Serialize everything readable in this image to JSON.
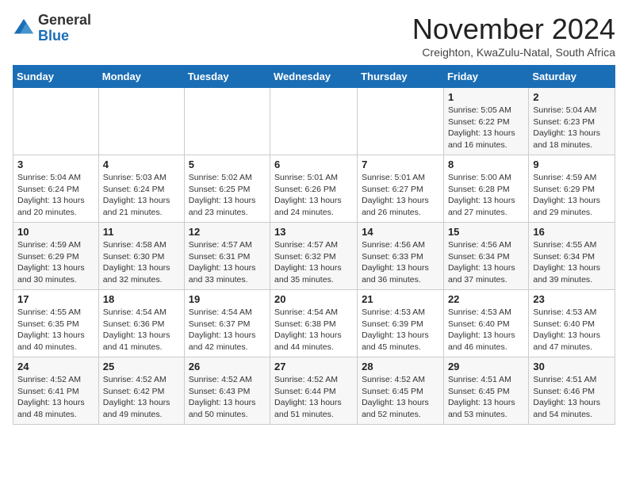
{
  "logo": {
    "text_general": "General",
    "text_blue": "Blue"
  },
  "title": "November 2024",
  "subtitle": "Creighton, KwaZulu-Natal, South Africa",
  "days_of_week": [
    "Sunday",
    "Monday",
    "Tuesday",
    "Wednesday",
    "Thursday",
    "Friday",
    "Saturday"
  ],
  "weeks": [
    [
      {
        "day": "",
        "info": ""
      },
      {
        "day": "",
        "info": ""
      },
      {
        "day": "",
        "info": ""
      },
      {
        "day": "",
        "info": ""
      },
      {
        "day": "",
        "info": ""
      },
      {
        "day": "1",
        "info": "Sunrise: 5:05 AM\nSunset: 6:22 PM\nDaylight: 13 hours and 16 minutes."
      },
      {
        "day": "2",
        "info": "Sunrise: 5:04 AM\nSunset: 6:23 PM\nDaylight: 13 hours and 18 minutes."
      }
    ],
    [
      {
        "day": "3",
        "info": "Sunrise: 5:04 AM\nSunset: 6:24 PM\nDaylight: 13 hours and 20 minutes."
      },
      {
        "day": "4",
        "info": "Sunrise: 5:03 AM\nSunset: 6:24 PM\nDaylight: 13 hours and 21 minutes."
      },
      {
        "day": "5",
        "info": "Sunrise: 5:02 AM\nSunset: 6:25 PM\nDaylight: 13 hours and 23 minutes."
      },
      {
        "day": "6",
        "info": "Sunrise: 5:01 AM\nSunset: 6:26 PM\nDaylight: 13 hours and 24 minutes."
      },
      {
        "day": "7",
        "info": "Sunrise: 5:01 AM\nSunset: 6:27 PM\nDaylight: 13 hours and 26 minutes."
      },
      {
        "day": "8",
        "info": "Sunrise: 5:00 AM\nSunset: 6:28 PM\nDaylight: 13 hours and 27 minutes."
      },
      {
        "day": "9",
        "info": "Sunrise: 4:59 AM\nSunset: 6:29 PM\nDaylight: 13 hours and 29 minutes."
      }
    ],
    [
      {
        "day": "10",
        "info": "Sunrise: 4:59 AM\nSunset: 6:29 PM\nDaylight: 13 hours and 30 minutes."
      },
      {
        "day": "11",
        "info": "Sunrise: 4:58 AM\nSunset: 6:30 PM\nDaylight: 13 hours and 32 minutes."
      },
      {
        "day": "12",
        "info": "Sunrise: 4:57 AM\nSunset: 6:31 PM\nDaylight: 13 hours and 33 minutes."
      },
      {
        "day": "13",
        "info": "Sunrise: 4:57 AM\nSunset: 6:32 PM\nDaylight: 13 hours and 35 minutes."
      },
      {
        "day": "14",
        "info": "Sunrise: 4:56 AM\nSunset: 6:33 PM\nDaylight: 13 hours and 36 minutes."
      },
      {
        "day": "15",
        "info": "Sunrise: 4:56 AM\nSunset: 6:34 PM\nDaylight: 13 hours and 37 minutes."
      },
      {
        "day": "16",
        "info": "Sunrise: 4:55 AM\nSunset: 6:34 PM\nDaylight: 13 hours and 39 minutes."
      }
    ],
    [
      {
        "day": "17",
        "info": "Sunrise: 4:55 AM\nSunset: 6:35 PM\nDaylight: 13 hours and 40 minutes."
      },
      {
        "day": "18",
        "info": "Sunrise: 4:54 AM\nSunset: 6:36 PM\nDaylight: 13 hours and 41 minutes."
      },
      {
        "day": "19",
        "info": "Sunrise: 4:54 AM\nSunset: 6:37 PM\nDaylight: 13 hours and 42 minutes."
      },
      {
        "day": "20",
        "info": "Sunrise: 4:54 AM\nSunset: 6:38 PM\nDaylight: 13 hours and 44 minutes."
      },
      {
        "day": "21",
        "info": "Sunrise: 4:53 AM\nSunset: 6:39 PM\nDaylight: 13 hours and 45 minutes."
      },
      {
        "day": "22",
        "info": "Sunrise: 4:53 AM\nSunset: 6:40 PM\nDaylight: 13 hours and 46 minutes."
      },
      {
        "day": "23",
        "info": "Sunrise: 4:53 AM\nSunset: 6:40 PM\nDaylight: 13 hours and 47 minutes."
      }
    ],
    [
      {
        "day": "24",
        "info": "Sunrise: 4:52 AM\nSunset: 6:41 PM\nDaylight: 13 hours and 48 minutes."
      },
      {
        "day": "25",
        "info": "Sunrise: 4:52 AM\nSunset: 6:42 PM\nDaylight: 13 hours and 49 minutes."
      },
      {
        "day": "26",
        "info": "Sunrise: 4:52 AM\nSunset: 6:43 PM\nDaylight: 13 hours and 50 minutes."
      },
      {
        "day": "27",
        "info": "Sunrise: 4:52 AM\nSunset: 6:44 PM\nDaylight: 13 hours and 51 minutes."
      },
      {
        "day": "28",
        "info": "Sunrise: 4:52 AM\nSunset: 6:45 PM\nDaylight: 13 hours and 52 minutes."
      },
      {
        "day": "29",
        "info": "Sunrise: 4:51 AM\nSunset: 6:45 PM\nDaylight: 13 hours and 53 minutes."
      },
      {
        "day": "30",
        "info": "Sunrise: 4:51 AM\nSunset: 6:46 PM\nDaylight: 13 hours and 54 minutes."
      }
    ]
  ]
}
